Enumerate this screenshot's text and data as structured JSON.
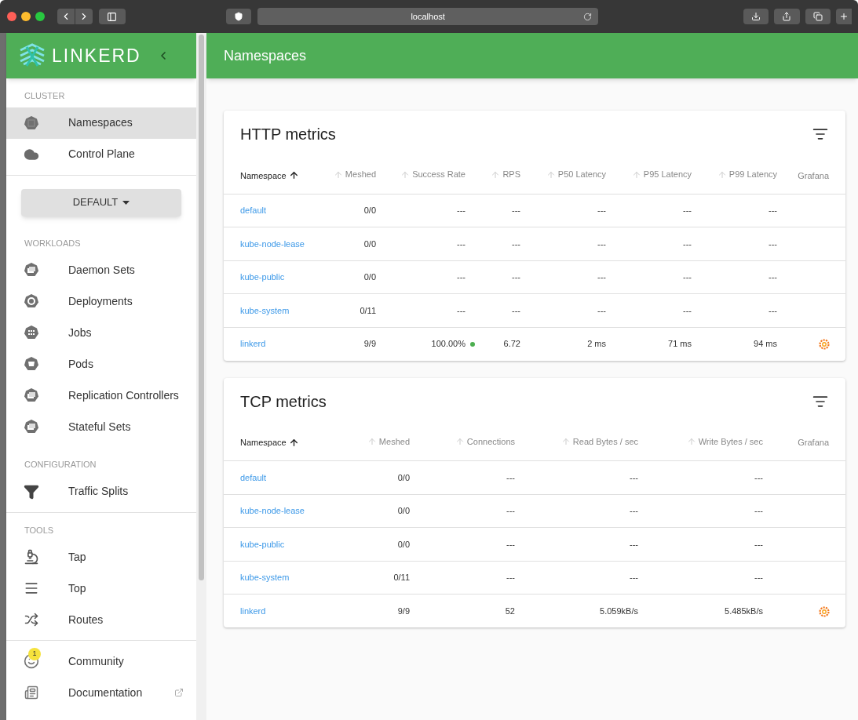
{
  "browser": {
    "url": "localhost"
  },
  "sidebar": {
    "logo": "LINKERD",
    "sections": [
      {
        "kind": "nav",
        "divided": false,
        "heading": "CLUSTER",
        "items": [
          {
            "label": "Namespaces",
            "selected": true
          },
          {
            "label": "Control Plane",
            "selected": false
          }
        ]
      },
      {
        "kind": "namespace_select",
        "divided": true,
        "value": "DEFAULT"
      },
      {
        "kind": "nav",
        "divided": false,
        "heading": "WORKLOADS",
        "items": [
          {
            "label": "Daemon Sets",
            "selected": false
          },
          {
            "label": "Deployments",
            "selected": false
          },
          {
            "label": "Jobs",
            "selected": false
          },
          {
            "label": "Pods",
            "selected": false
          },
          {
            "label": "Replication Controllers",
            "selected": false
          },
          {
            "label": "Stateful Sets",
            "selected": false
          }
        ]
      },
      {
        "kind": "nav",
        "divided": false,
        "heading": "CONFIGURATION",
        "items": [
          {
            "label": "Traffic Splits",
            "selected": false
          }
        ]
      },
      {
        "kind": "nav",
        "divided": true,
        "heading": "TOOLS",
        "items": [
          {
            "label": "Tap",
            "selected": false
          },
          {
            "label": "Top",
            "selected": false
          },
          {
            "label": "Routes",
            "selected": false
          }
        ]
      },
      {
        "kind": "nav",
        "divided": true,
        "items": [
          {
            "label": "Community",
            "selected": false,
            "badge": "1"
          },
          {
            "label": "Documentation",
            "selected": false,
            "external": true
          }
        ]
      }
    ]
  },
  "header": {
    "title": "Namespaces"
  },
  "tables": [
    {
      "title": "HTTP metrics",
      "columns": [
        {
          "label": "Namespace",
          "sortable": true,
          "sorted": true
        },
        {
          "label": "Meshed",
          "sortable": true,
          "sorted": false
        },
        {
          "label": "Success Rate",
          "sortable": true,
          "sorted": false
        },
        {
          "label": "RPS",
          "sortable": true,
          "sorted": false
        },
        {
          "label": "P50 Latency",
          "sortable": true,
          "sorted": false
        },
        {
          "label": "P95 Latency",
          "sortable": true,
          "sorted": false
        },
        {
          "label": "P99 Latency",
          "sortable": true,
          "sorted": false
        },
        {
          "label": "Grafana",
          "sortable": false,
          "sorted": false
        }
      ],
      "rows": [
        {
          "cells": [
            "default",
            "0/0",
            "---",
            "---",
            "---",
            "---",
            "---"
          ],
          "healthy": false,
          "grafana_link": false
        },
        {
          "cells": [
            "kube-node-lease",
            "0/0",
            "---",
            "---",
            "---",
            "---",
            "---"
          ],
          "healthy": false,
          "grafana_link": false
        },
        {
          "cells": [
            "kube-public",
            "0/0",
            "---",
            "---",
            "---",
            "---",
            "---"
          ],
          "healthy": false,
          "grafana_link": false
        },
        {
          "cells": [
            "kube-system",
            "0/11",
            "---",
            "---",
            "---",
            "---",
            "---"
          ],
          "healthy": false,
          "grafana_link": false
        },
        {
          "cells": [
            "linkerd",
            "9/9",
            "100.00%",
            "6.72",
            "2 ms",
            "71 ms",
            "94 ms"
          ],
          "healthy": true,
          "grafana_link": true
        }
      ]
    },
    {
      "title": "TCP metrics",
      "columns": [
        {
          "label": "Namespace",
          "sortable": true,
          "sorted": true
        },
        {
          "label": "Meshed",
          "sortable": true,
          "sorted": false
        },
        {
          "label": "Connections",
          "sortable": true,
          "sorted": false
        },
        {
          "label": "Read Bytes / sec",
          "sortable": true,
          "sorted": false
        },
        {
          "label": "Write Bytes / sec",
          "sortable": true,
          "sorted": false
        },
        {
          "label": "Grafana",
          "sortable": false,
          "sorted": false
        }
      ],
      "rows": [
        {
          "cells": [
            "default",
            "0/0",
            "---",
            "---",
            "---"
          ],
          "grafana_link": false
        },
        {
          "cells": [
            "kube-node-lease",
            "0/0",
            "---",
            "---",
            "---"
          ],
          "grafana_link": false
        },
        {
          "cells": [
            "kube-public",
            "0/0",
            "---",
            "---",
            "---"
          ],
          "grafana_link": false
        },
        {
          "cells": [
            "kube-system",
            "0/11",
            "---",
            "---",
            "---"
          ],
          "grafana_link": false
        },
        {
          "cells": [
            "linkerd",
            "9/9",
            "52",
            "5.059kB/s",
            "5.485kB/s"
          ],
          "grafana_link": true
        }
      ]
    }
  ]
}
